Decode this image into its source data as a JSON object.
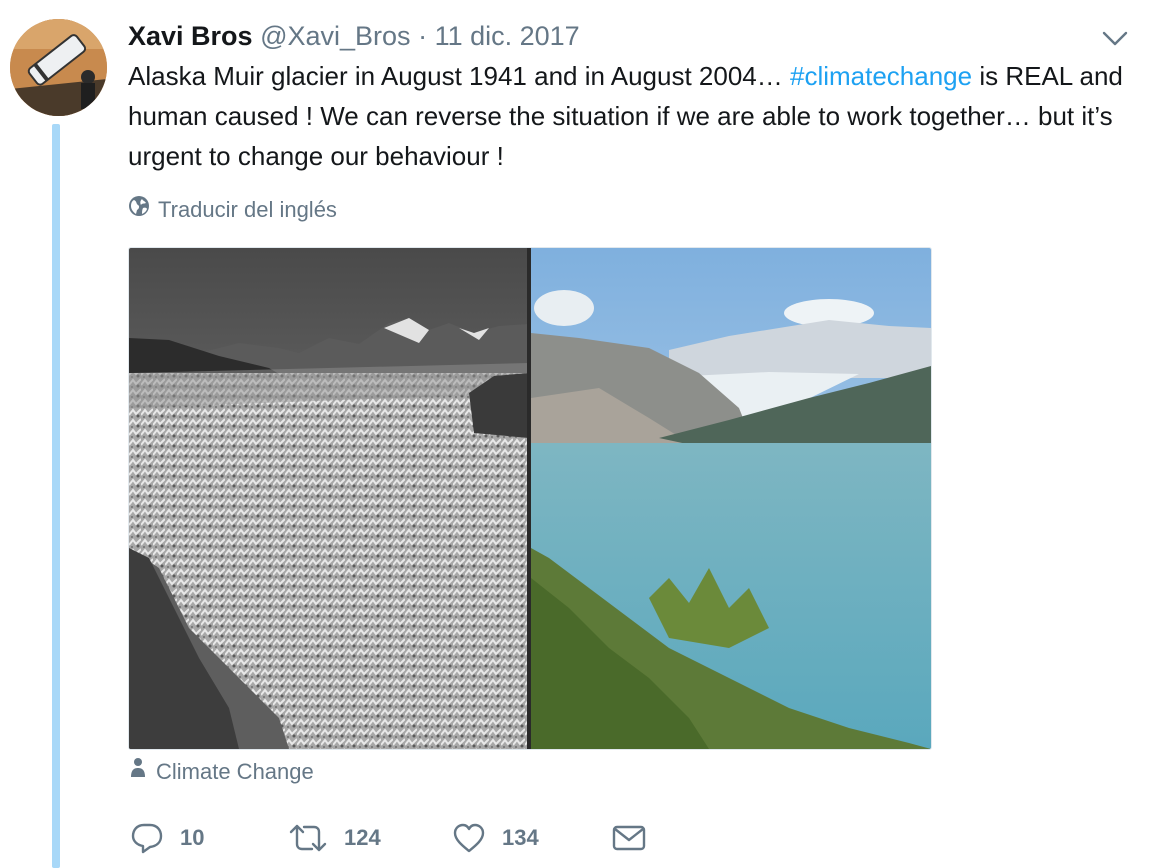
{
  "tweet": {
    "author_name": "Xavi Bros",
    "author_handle": "@Xavi_Bros",
    "separator": "·",
    "date": "11 dic. 2017",
    "text_before": "Alaska Muir glacier in August 1941  and in August 2004… ",
    "hashtag": "#climatechange",
    "text_after": " is REAL and human caused ! We can reverse the situation if we are able to work together… but it’s urgent to change our behaviour !",
    "translate_label": "Traducir del inglés",
    "media_credit": "Climate Change"
  },
  "actions": {
    "replies": "10",
    "retweets": "124",
    "likes": "134"
  },
  "colors": {
    "link": "#1da1f2",
    "muted": "#657786",
    "thread_line": "#a8d8f8"
  },
  "icons": [
    "caret-down-icon",
    "globe-icon",
    "person-icon",
    "reply-icon",
    "retweet-icon",
    "like-icon",
    "message-icon"
  ]
}
